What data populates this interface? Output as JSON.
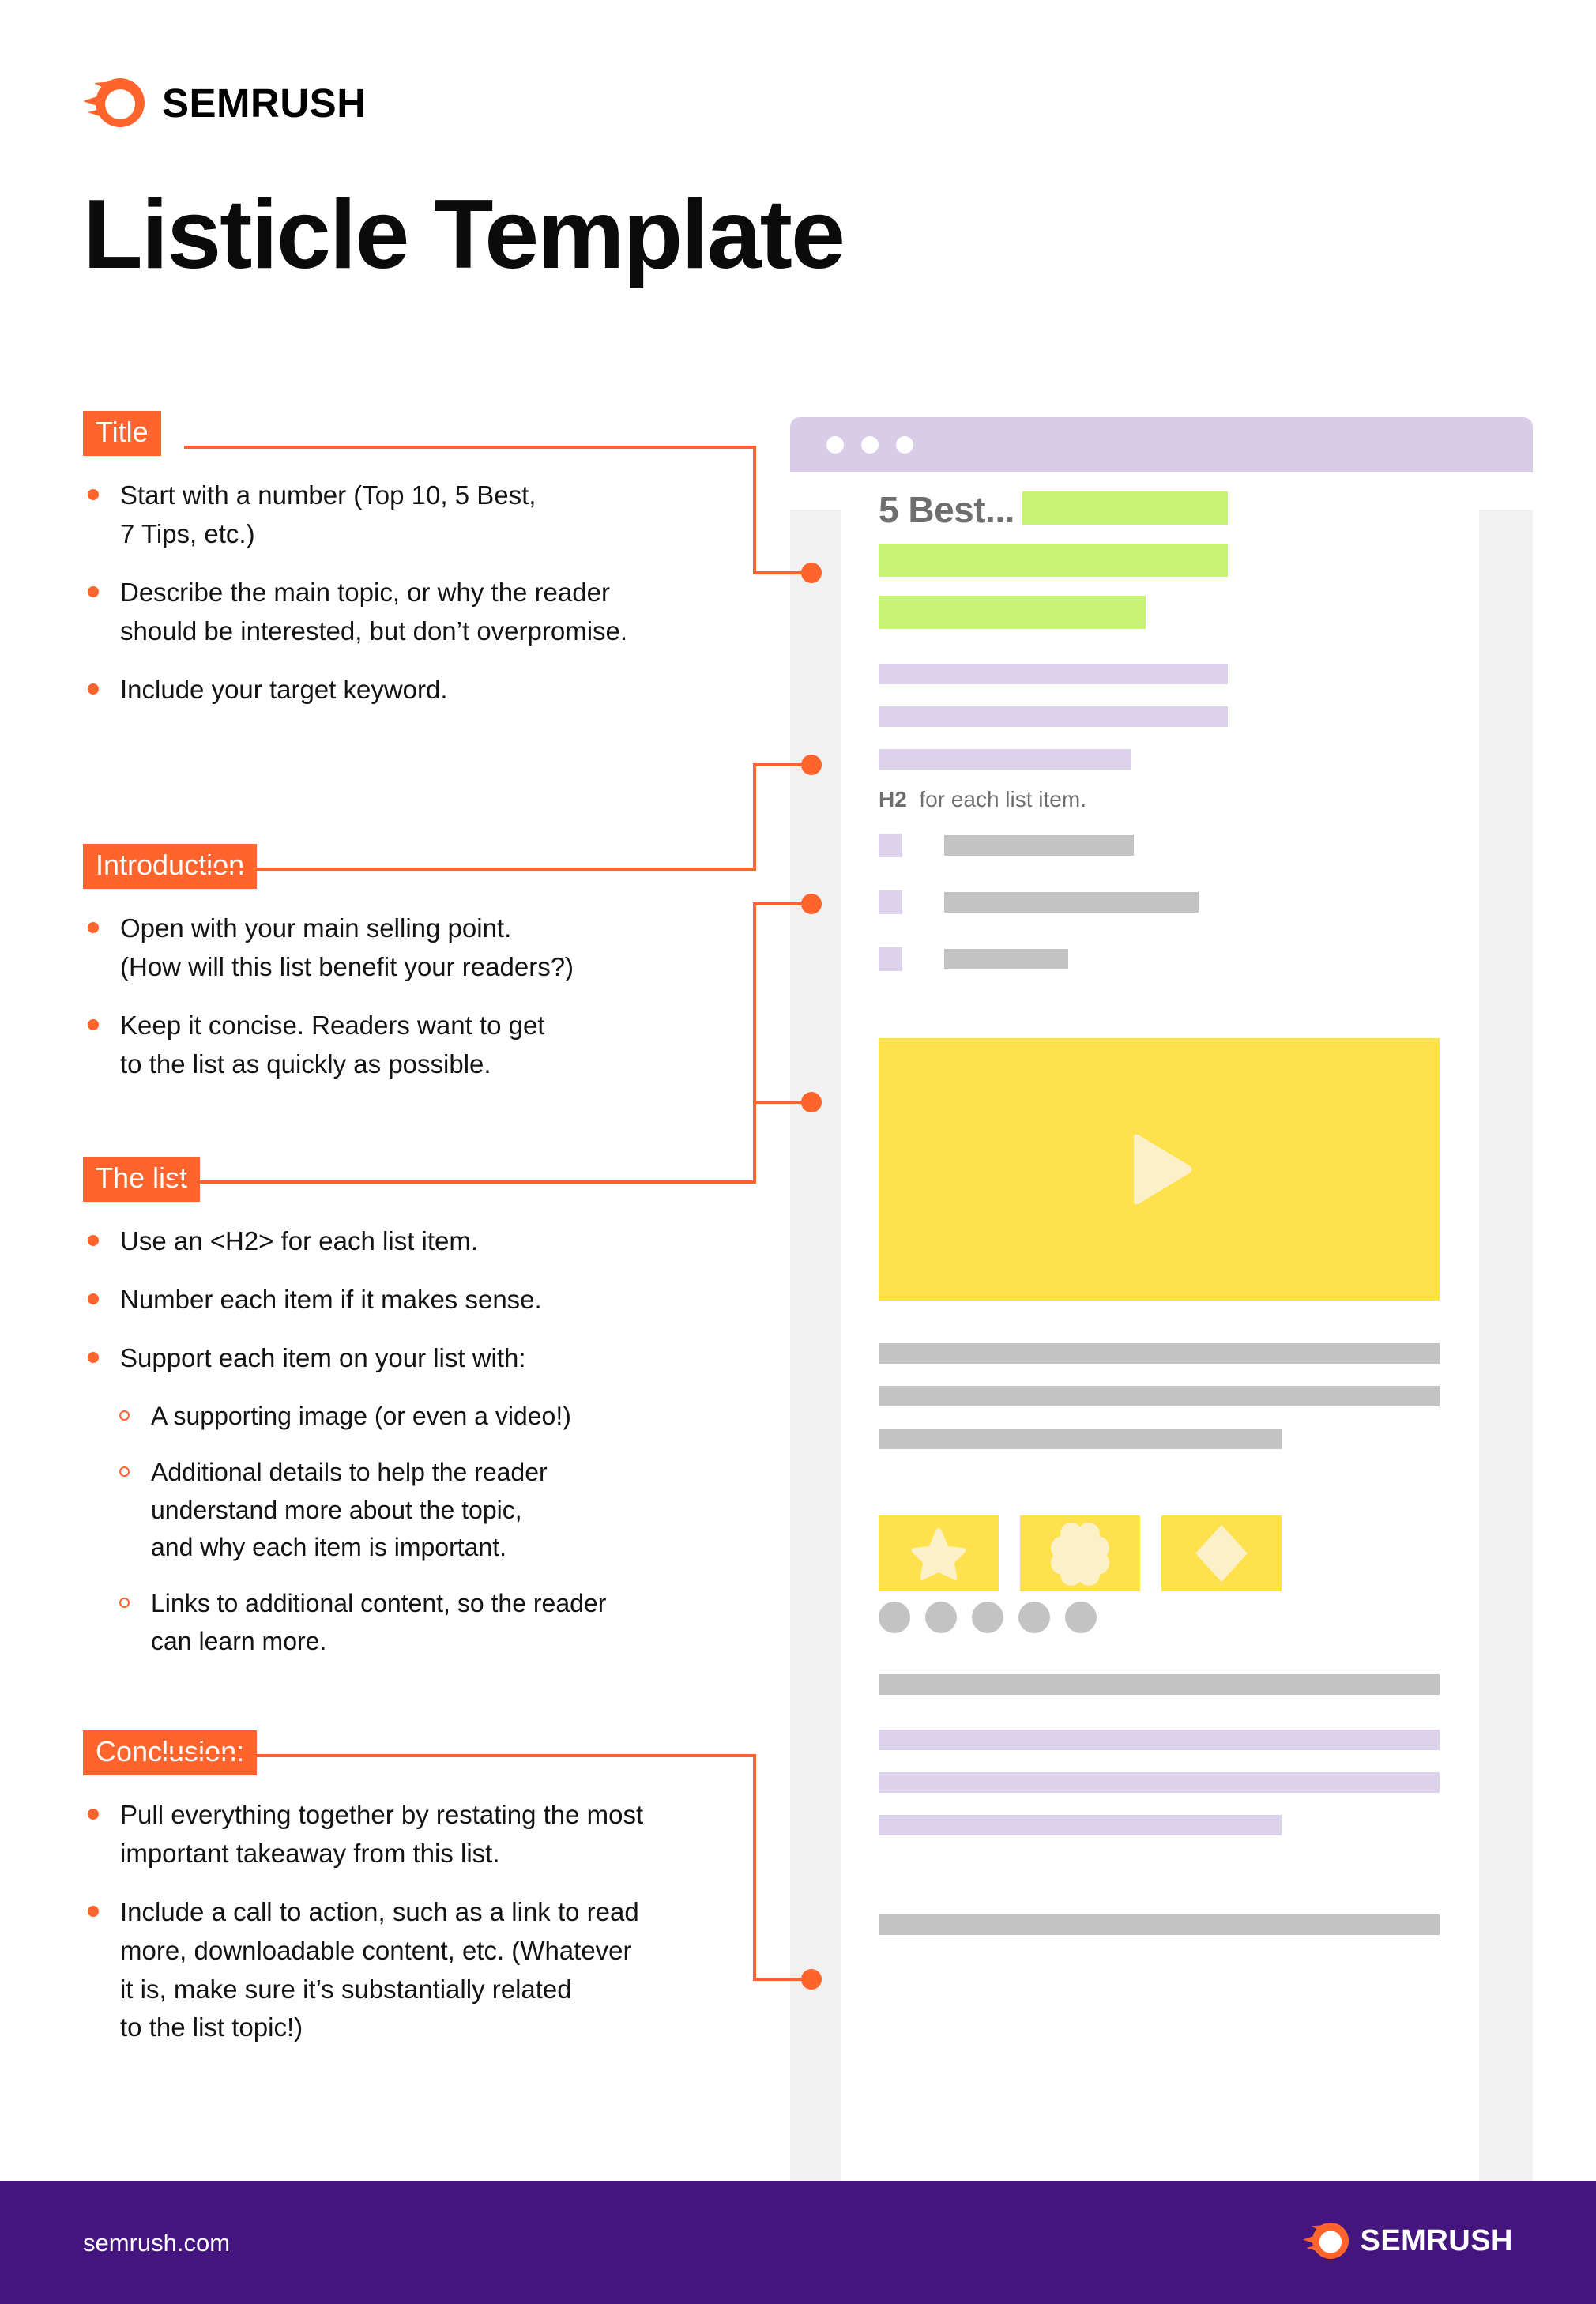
{
  "brand": {
    "name": "SEMRUSH",
    "logo_icon": "semrush-comet-icon",
    "accent_color": "#FF642D"
  },
  "page_title": "Listicle Template",
  "sections": [
    {
      "badge": "Title",
      "bullets": [
        "Start with a number (Top 10, 5 Best,\n7 Tips, etc.)",
        "Describe the main topic, or why the reader\nshould be interested, but don’t overpromise.",
        "Include your target keyword."
      ],
      "sub_bullets": []
    },
    {
      "badge": "Introduction",
      "bullets": [
        "Open with your main selling point.\n(How will this list benefit your readers?)",
        "Keep it concise. Readers want to get\nto the list as quickly as possible."
      ],
      "sub_bullets": []
    },
    {
      "badge": "The list",
      "bullets": [
        "Use an <H2> for each list item.",
        "Number each item if it makes sense.",
        "Support each item on your list with:"
      ],
      "sub_bullets": [
        "A supporting image (or even a video!)",
        "Additional details to help the reader\nunderstand more about the topic,\nand why each item is important.",
        "Links to additional content, so the reader\ncan learn more."
      ]
    },
    {
      "badge": "Conclusion:",
      "bullets": [
        "Pull everything together by restating the most\nimportant takeaway from this list.",
        "Include a call to action, such as a link to read\nmore, downloadable content, etc. (Whatever\nit is, make sure it’s substantially related\nto the list topic!)"
      ],
      "sub_bullets": []
    }
  ],
  "mockup": {
    "window_dots": 3,
    "heading": "5 Best...",
    "h2_label": "H2",
    "h2_rest": "for each list item.",
    "video_icon": "play-triangle-icon",
    "tile_icons": [
      "star-icon",
      "flower-icon",
      "diamond-icon"
    ],
    "avatar_circles": 5,
    "colors": {
      "browser_bar": "#D9CCE9",
      "green_bar": "#C7F573",
      "lavender_bar": "#DCD2EB",
      "gray_bar": "#C3C3C3",
      "yellow_block": "#FFE14D",
      "page_backdrop": "#F1F1F1"
    }
  },
  "footer": {
    "url": "semrush.com",
    "brand": "SEMRUSH",
    "logo_icon": "semrush-comet-icon",
    "background": "#44157F"
  }
}
